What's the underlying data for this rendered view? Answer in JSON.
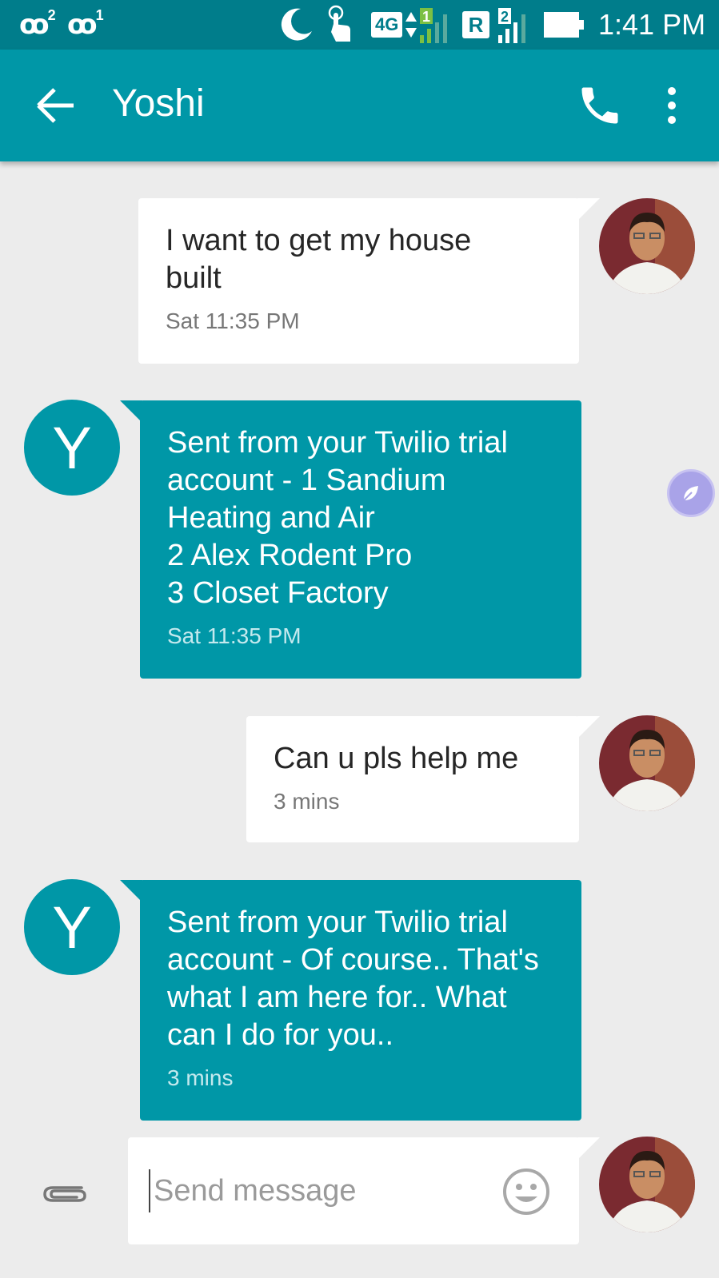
{
  "status_bar": {
    "voicemail_1_count": "2",
    "voicemail_2_count": "1",
    "network_type": "4G",
    "sim1_label": "1",
    "roaming_label": "R",
    "sim2_label": "2",
    "time": "1:41 PM"
  },
  "app_bar": {
    "contact_name": "Yoshi",
    "back_icon": "arrow-back-icon",
    "call_icon": "phone-icon",
    "more_icon": "more-vert-icon"
  },
  "messages": [
    {
      "direction": "outgoing",
      "text": "I want to get my house\nbuilt",
      "time": "Sat 11:35 PM"
    },
    {
      "direction": "incoming",
      "avatar_letter": "Y",
      "text": "Sent from your Twilio trial\naccount - 1 Sandium\nHeating and Air\n2 Alex Rodent Pro\n3 Closet Factory",
      "time": "Sat 11:35 PM"
    },
    {
      "direction": "outgoing",
      "text": "Can u pls help me",
      "time": "3 mins"
    },
    {
      "direction": "incoming",
      "avatar_letter": "Y",
      "text": "Sent from your Twilio trial\naccount - Of course.. That's\nwhat I am here for.. What\ncan I do for you..",
      "time": "3 mins"
    }
  ],
  "composer": {
    "placeholder": "Send message",
    "value": "",
    "attach_icon": "paperclip-icon",
    "emoji_icon": "smiley-icon"
  },
  "colors": {
    "status_bar": "#007d8b",
    "app_bar": "#0097a7",
    "incoming_bubble": "#0097a7",
    "outgoing_bubble": "#ffffff",
    "background": "#ececec"
  }
}
